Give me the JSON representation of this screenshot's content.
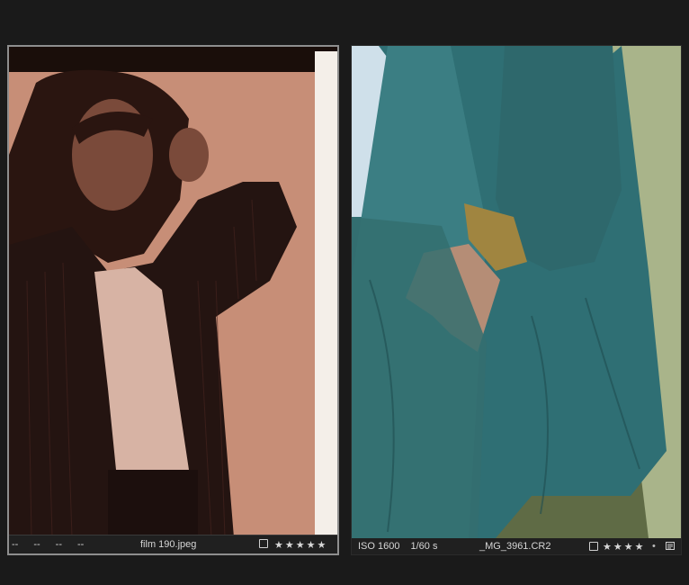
{
  "thumbnails": [
    {
      "filename": "film 190.jpeg",
      "info_placeholders": [
        "--",
        "--",
        "--",
        "--"
      ],
      "rating_stars": "★★★★★",
      "selected": true
    },
    {
      "filename": "_MG_3961.CR2",
      "iso": "ISO 1600",
      "shutter": "1/60 s",
      "rating_stars": "★★★★",
      "rating_dot": "•",
      "selected": false
    }
  ],
  "colors": {
    "background": "#1a1a1a",
    "selected_border": "#8e8e8e",
    "info_bar": "#202020"
  }
}
